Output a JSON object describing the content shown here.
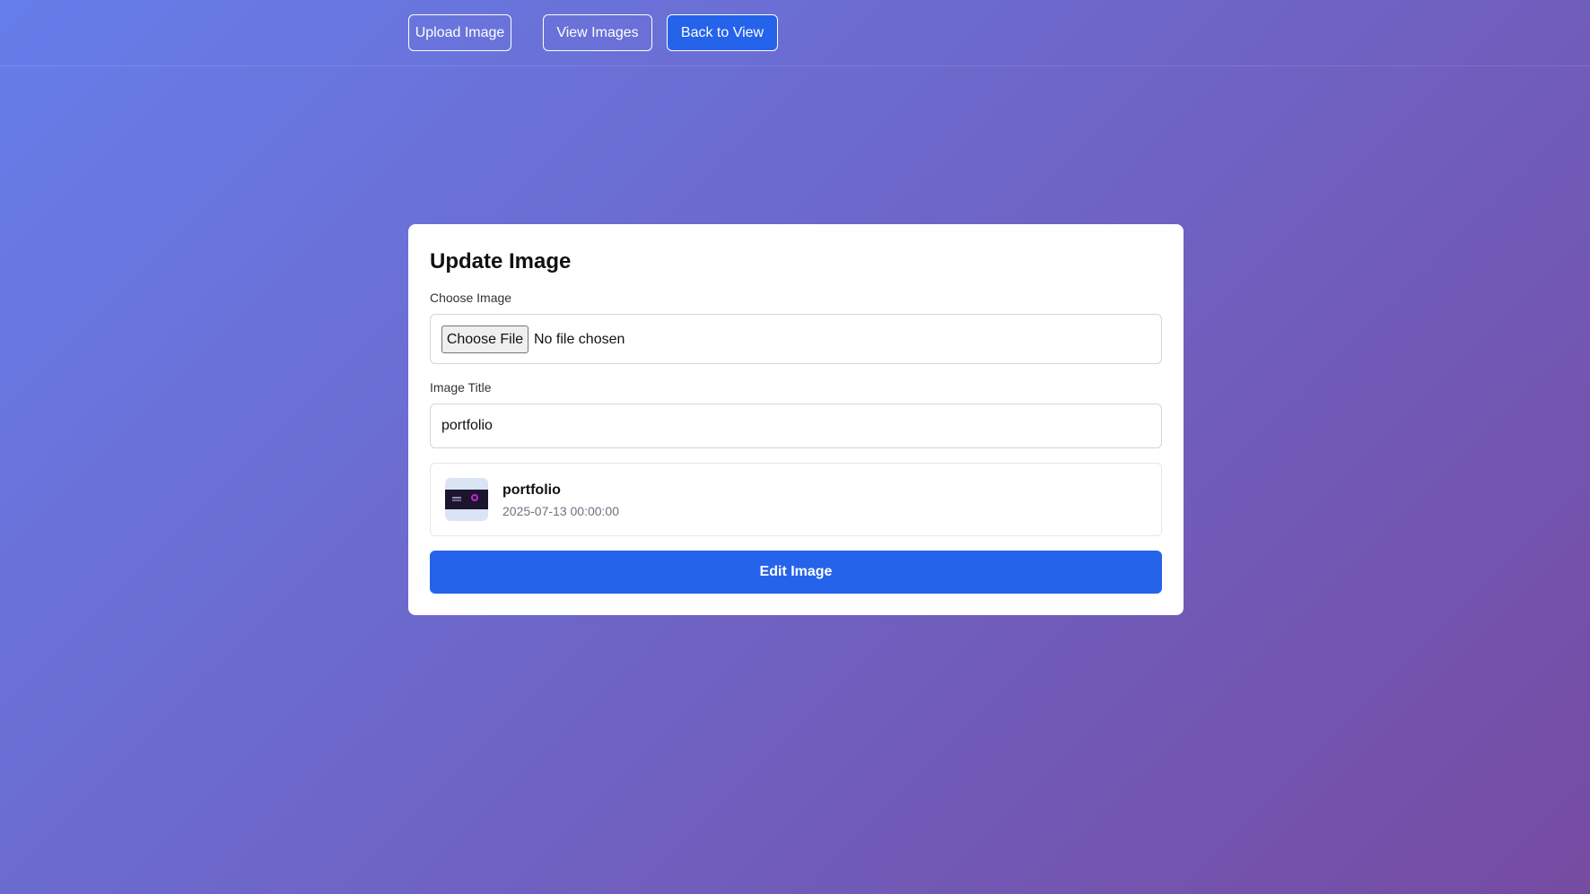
{
  "nav": {
    "upload_label": "Upload Image",
    "view_label": "View Images",
    "back_label": "Back to View"
  },
  "form": {
    "heading": "Update Image",
    "file_label": "Choose Image",
    "file_button_label": "Choose File",
    "file_status": "No file chosen",
    "title_label": "Image Title",
    "title_value": "portfolio",
    "submit_label": "Edit Image"
  },
  "preview": {
    "title": "portfolio",
    "date": "2025-07-13 00:00:00",
    "thumbnail_icon": "image-thumbnail-icon"
  },
  "colors": {
    "gradient_start": "#667eea",
    "gradient_end": "#764ba2",
    "accent": "#2563eb"
  }
}
